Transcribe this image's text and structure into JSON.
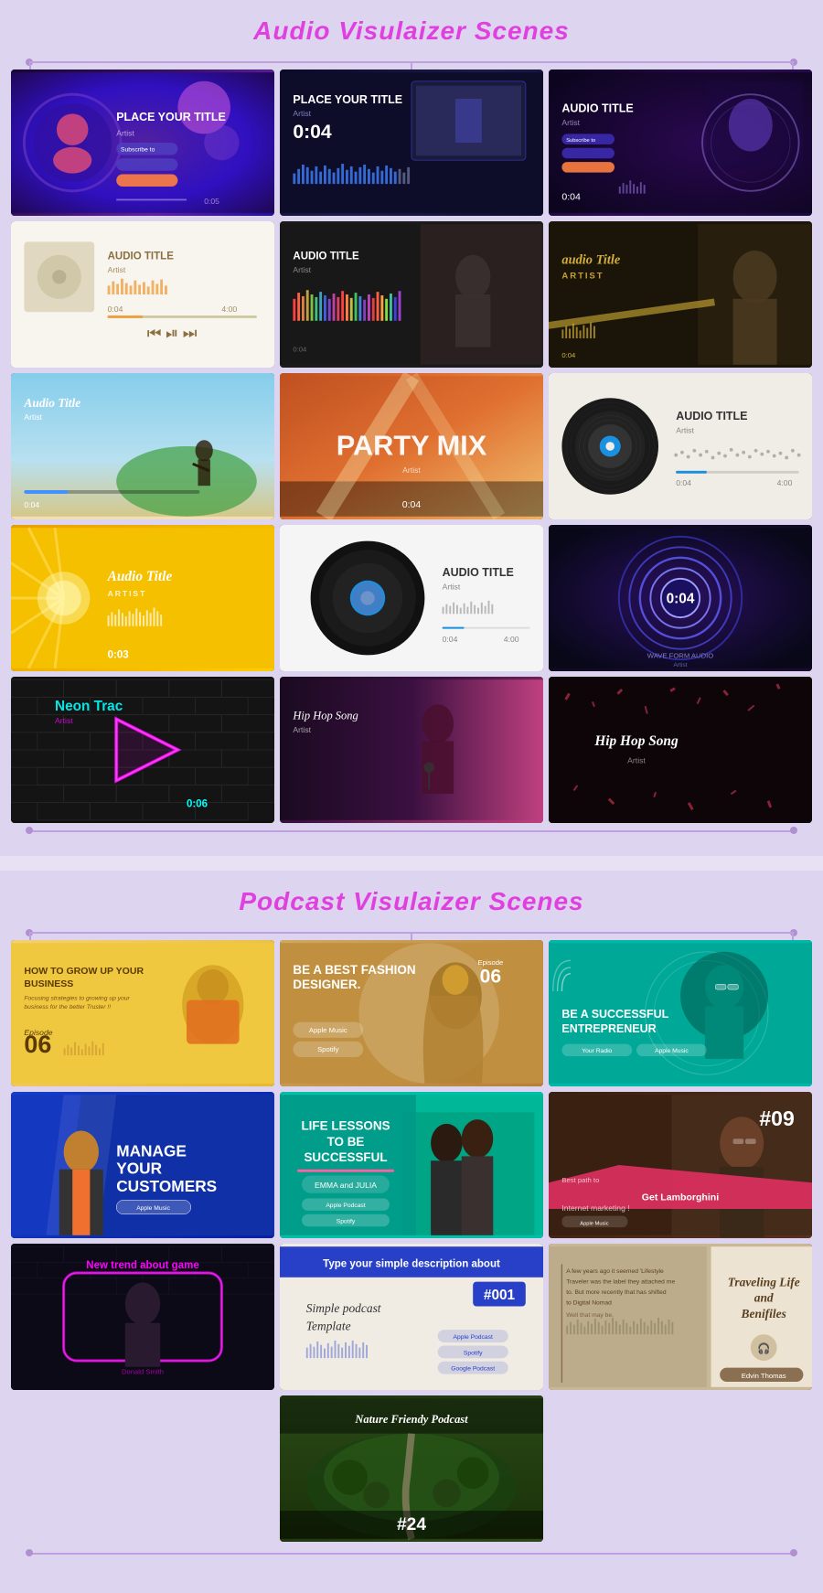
{
  "audio_section": {
    "title": "Audio Visulaizer Scenes",
    "cards": [
      {
        "id": 1,
        "title": "PLACE YOUR TITLE",
        "subtitle": "Artist",
        "time": "0:05",
        "style": "purple-gradient"
      },
      {
        "id": 2,
        "title": "PLACE YOUR TITLE",
        "subtitle": "Artist",
        "time": "0:04",
        "style": "dark-blue"
      },
      {
        "id": 3,
        "title": "AUDIO TITLE",
        "subtitle": "Artist",
        "time": "0:04",
        "style": "dark-purple"
      },
      {
        "id": 4,
        "title": "AUDIO TITLE",
        "subtitle": "Artist",
        "time": "0:04",
        "style": "white"
      },
      {
        "id": 5,
        "title": "AUDIO TITLE",
        "subtitle": "Artist",
        "time": "0:04",
        "style": "dark-mono"
      },
      {
        "id": 6,
        "title": "audio Title",
        "subtitle": "ARTIST",
        "time": "0:04",
        "style": "dark-gold"
      },
      {
        "id": 7,
        "title": "Audio Title",
        "subtitle": "Artist",
        "time": "0:04",
        "style": "beach"
      },
      {
        "id": 8,
        "title": "PARTY MIX",
        "subtitle": "Artist",
        "time": "0:04",
        "style": "warm-gradient"
      },
      {
        "id": 9,
        "title": "AUDIO TITLE",
        "subtitle": "Artist",
        "time": "0:04",
        "style": "light-minimal"
      },
      {
        "id": 10,
        "title": "Audio Title",
        "subtitle": "ARTIST",
        "time": "0:03",
        "style": "sunburst"
      },
      {
        "id": 11,
        "title": "AUDIO TITLE",
        "subtitle": "Artist",
        "time": "0:04",
        "style": "vinyl-white"
      },
      {
        "id": 12,
        "title": "0:04",
        "subtitle": "WAVE FORM AUDIO / Artist",
        "time": "0:04",
        "style": "neon-rings"
      },
      {
        "id": 13,
        "title": "Neon Trac",
        "subtitle": "Artist",
        "time": "0:06",
        "style": "neon-brick"
      },
      {
        "id": 14,
        "title": "Hip Hop Song",
        "subtitle": "Artist",
        "time": "",
        "style": "hiphop-red"
      },
      {
        "id": 15,
        "title": "Hip Hop Song",
        "subtitle": "Artist",
        "time": "",
        "style": "hiphop-dark"
      }
    ]
  },
  "podcast_section": {
    "title": "Podcast Visulaizer Scenes",
    "cards": [
      {
        "id": 1,
        "title": "HOW TO GROW UP YOUR BUSINESS",
        "episode": "Episode 06",
        "style": "yellow-bg"
      },
      {
        "id": 2,
        "title": "BE A BEST FASHION DESIGNER.",
        "episode": "Episode 06",
        "style": "tan-bg"
      },
      {
        "id": 3,
        "title": "BE A SUCCESSFUL ENTREPRENEUR",
        "episode": "",
        "style": "teal-bg"
      },
      {
        "id": 4,
        "title": "MANAGE YOUR CUSTOMERS",
        "episode": "",
        "style": "blue-bg"
      },
      {
        "id": 5,
        "title": "LIFE LESSONS TO BE SUCCESSFUL",
        "subtitle": "EMMA and JULIA",
        "style": "teal-green"
      },
      {
        "id": 6,
        "title": "#09 Best path to Get Lamborghini",
        "subtitle": "Internet marketing !",
        "style": "dark-brown"
      },
      {
        "id": 7,
        "title": "New trend about game",
        "episode": "",
        "style": "dark-neon"
      },
      {
        "id": 8,
        "title": "Simple podcast Template",
        "episode": "#001",
        "style": "light-bg"
      },
      {
        "id": 9,
        "title": "Traveling Life and Benifiles",
        "subtitle": "Edvin Thomas",
        "style": "warm-photo"
      },
      {
        "id": 10,
        "title": "Nature Friendy Podcast",
        "episode": "#24",
        "style": "nature-aerial"
      }
    ]
  }
}
